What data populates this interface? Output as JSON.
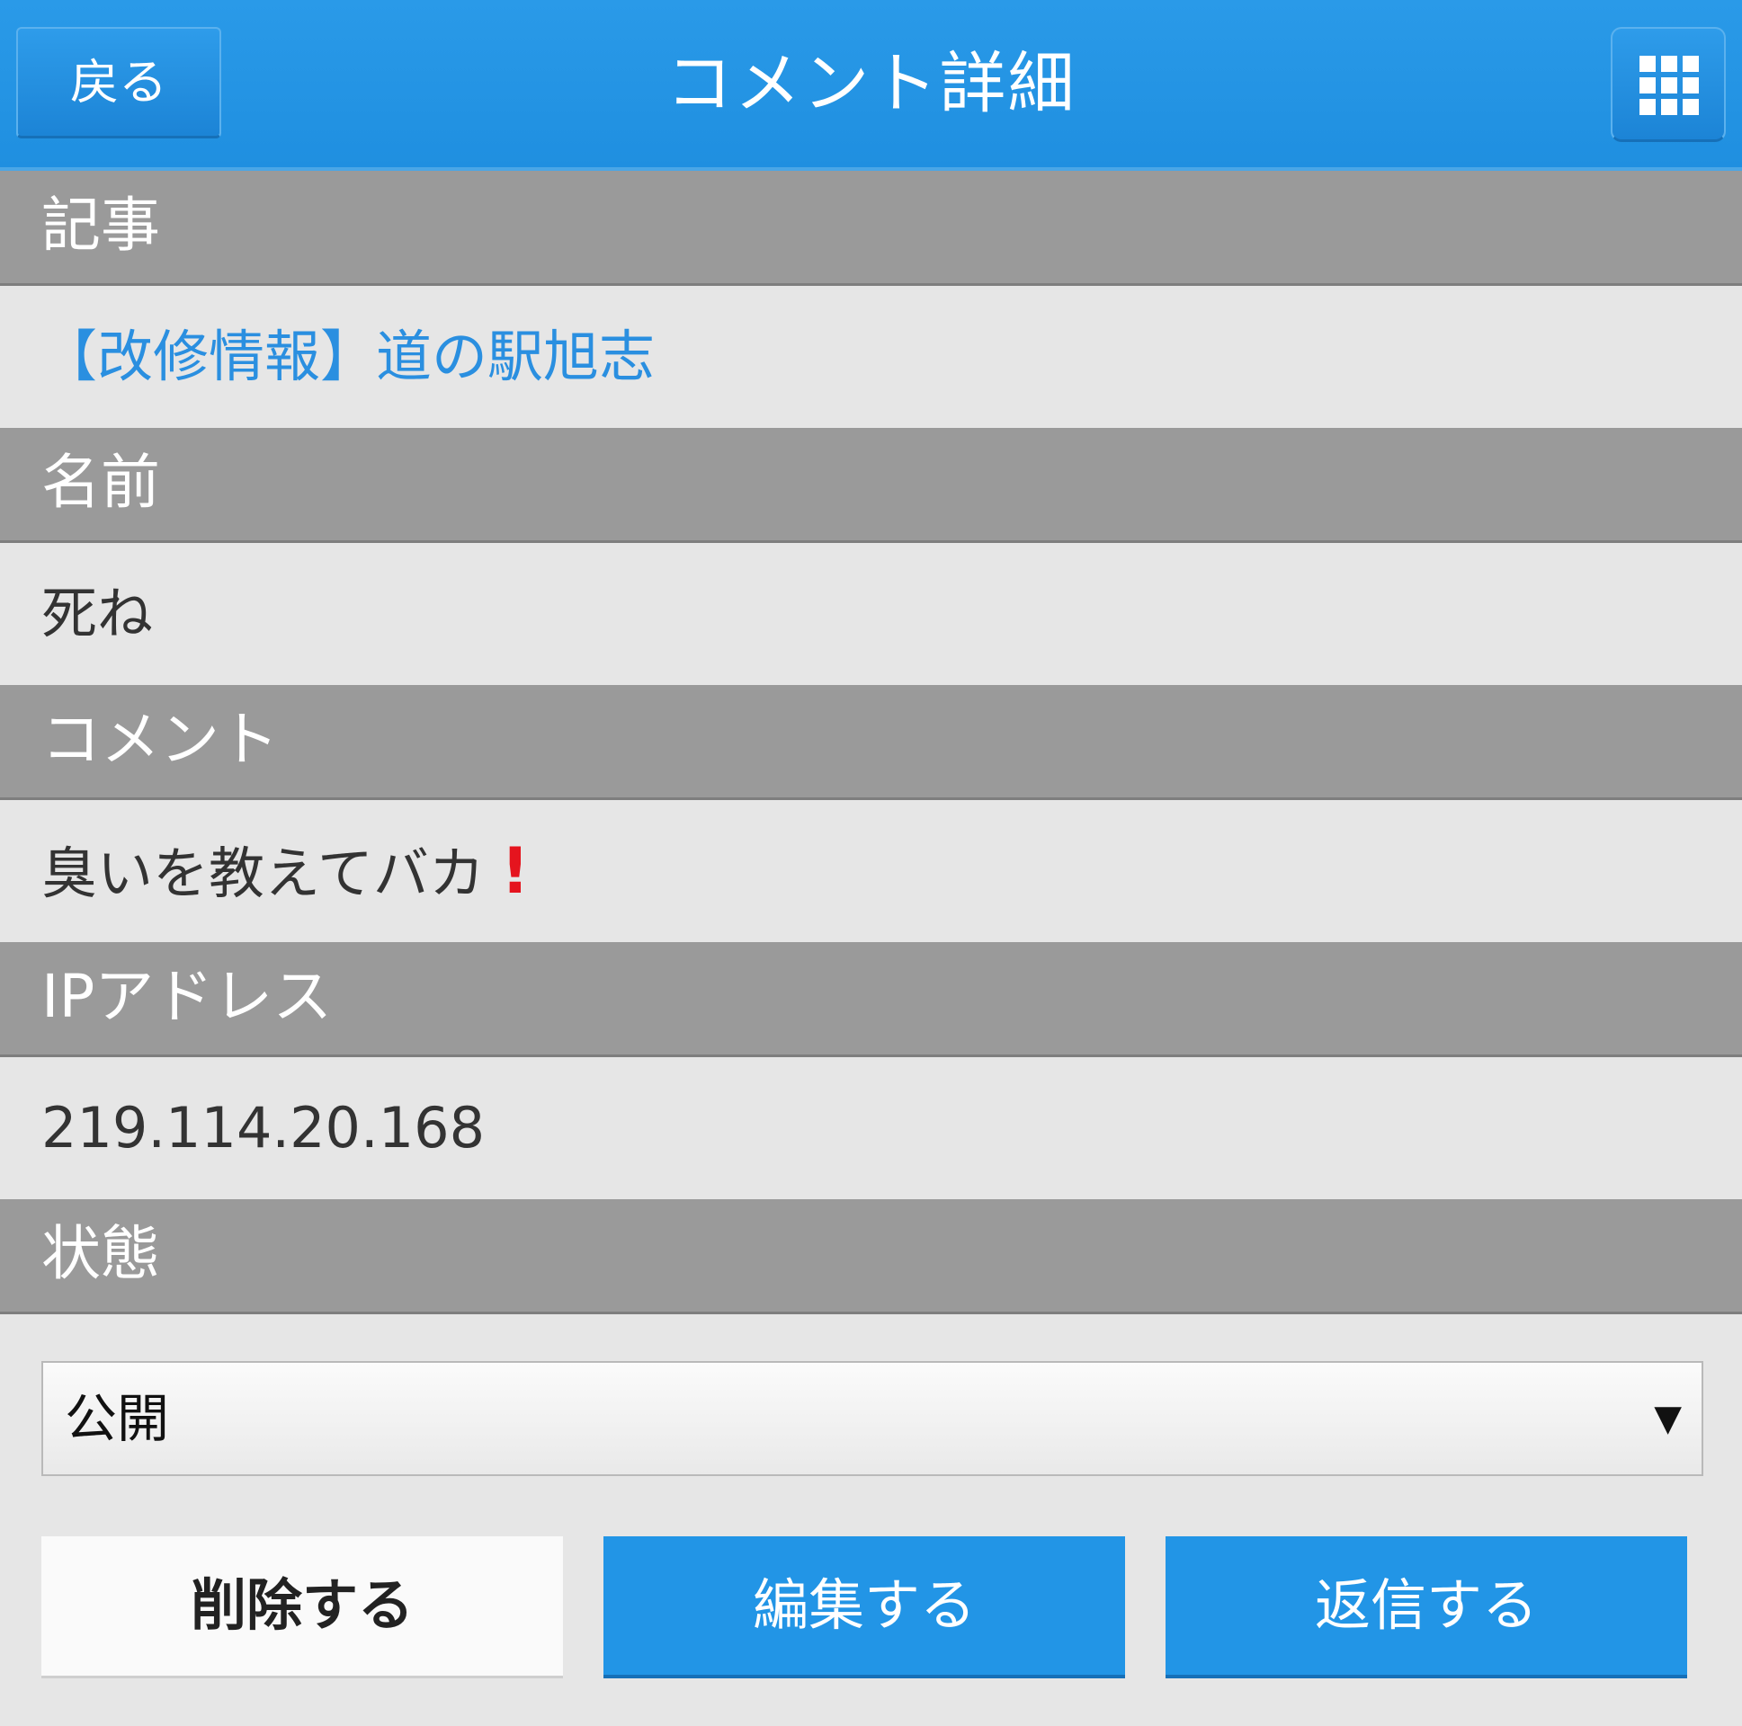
{
  "header": {
    "back_label": "戻る",
    "title": "コメント詳細",
    "menu_icon": "grid-icon"
  },
  "article": {
    "label": "記事",
    "link_text": "【改修情報】道の駅旭志"
  },
  "name": {
    "label": "名前",
    "value": "死ね"
  },
  "comment": {
    "label": "コメント",
    "value": "臭いを教えてバカ",
    "emphasis": "!"
  },
  "ip": {
    "label": "IPアドレス",
    "value": "219.114.20.168"
  },
  "status": {
    "label": "状態",
    "selected": "公開",
    "arrow": "▼"
  },
  "actions": {
    "delete_label": "削除する",
    "edit_label": "編集する",
    "reply_label": "返信する"
  },
  "colors": {
    "header_blue": "#2295e6",
    "link_blue": "#2a8fe0",
    "section_gray": "#9a9a9a",
    "alert_red": "#e5141e"
  }
}
